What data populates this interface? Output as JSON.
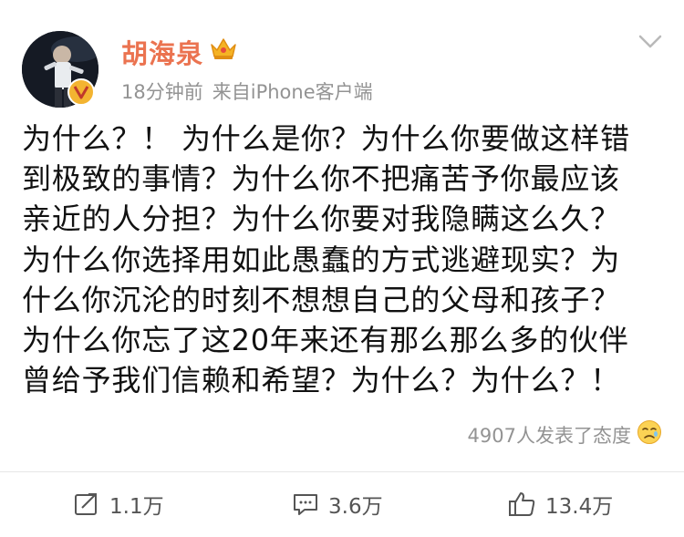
{
  "user": {
    "name": "胡海泉",
    "badge_icon": "crown-icon",
    "verified_icon": "verified-v-icon"
  },
  "meta": {
    "time": "18分钟前",
    "source": "来自iPhone客户端"
  },
  "post": {
    "lines": [
      "为什么？！ 为什么是你？为什么你要做这样错",
      "到极致的事情？为什么你不把痛苦予你最应该",
      "亲近的人分担？为什么你要对我隐瞒这么久？",
      "为什么你选择用如此愚蠢的方式逃避现实？为",
      "什么你沉沦的时刻不想想自己的父母和孩子？",
      "为什么你忘了这20年来还有那么那么多的伙伴",
      "曾给予我们信赖和希望？为什么？为什么？！"
    ]
  },
  "reactions": {
    "text": "4907人发表了态度",
    "emoji_icon": "sad-face-emoji-icon"
  },
  "actions": {
    "repost": "1.1万",
    "comment": "3.6万",
    "like": "13.4万"
  },
  "colors": {
    "username": "#eb7350",
    "meta": "#939393",
    "text": "#111111",
    "badge": "#f3b431"
  }
}
